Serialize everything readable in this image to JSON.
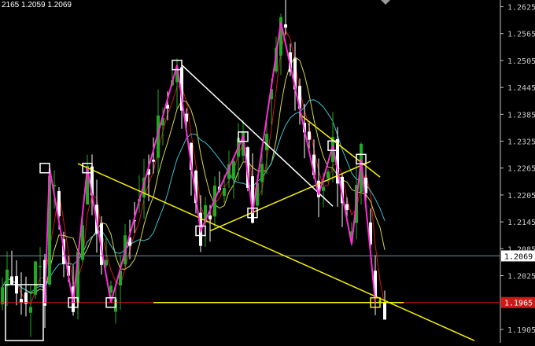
{
  "header": {
    "ohlc_text": "2165 1.2059 1.2069"
  },
  "colors": {
    "background": "#000000",
    "axis": "#c8c8c8",
    "bull_candle": "#1faa1f",
    "bear_candle": "#ffffff",
    "zigzag": "#ff2bd6",
    "trend_yellow": "#f5f200",
    "trend_white": "#ffffff",
    "ma_red": "#d01818",
    "ma_yellow": "#d6d650",
    "ma_cyan": "#3fbfcf",
    "current_price_line": "#7a8a9a",
    "alert_line": "#d01818",
    "current_price_badge_bg": "#ffffff",
    "current_price_badge_fg": "#000000",
    "alert_badge_bg": "#d01818",
    "alert_badge_fg": "#ffffff"
  },
  "price_axis": {
    "labels": [
      "1.2625",
      "1.2565",
      "1.2505",
      "1.2445",
      "1.2385",
      "1.2325",
      "1.2265",
      "1.2205",
      "1.2145",
      "1.2085",
      "1.2025",
      "1.1905"
    ],
    "current_price": "1.2069",
    "alert_price": "1.1965"
  },
  "chart_data": {
    "type": "candlestick",
    "y_range": [
      1.1875,
      1.264
    ],
    "candle_count": 82,
    "zigzag": [
      [
        9,
        1.1965
      ],
      [
        10,
        1.2265
      ],
      [
        15,
        1.1965
      ],
      [
        18,
        1.2265
      ],
      [
        23,
        1.1965
      ],
      [
        37,
        1.2495
      ],
      [
        42,
        1.2125
      ],
      [
        51,
        1.2335
      ],
      [
        53,
        1.2165
      ],
      [
        59,
        1.259
      ],
      [
        67,
        1.2205
      ],
      [
        70,
        1.2315
      ],
      [
        74,
        1.2095
      ],
      [
        76,
        1.2285
      ],
      [
        78,
        1.2075
      ],
      [
        79,
        1.1965
      ]
    ],
    "boxes": [
      [
        9,
        1.2265
      ],
      [
        15,
        1.1965
      ],
      [
        18,
        1.2265
      ],
      [
        23,
        1.1965
      ],
      [
        37,
        1.2495
      ],
      [
        42,
        1.2125
      ],
      [
        51,
        1.2335
      ],
      [
        53,
        1.2165
      ],
      [
        70,
        1.2315
      ],
      [
        76,
        1.2285
      ],
      [
        79,
        1.1965
      ]
    ],
    "trendlines": [
      {
        "color": "yellow",
        "from": [
          16,
          1.2275
        ],
        "to": [
          100,
          1.188
        ]
      },
      {
        "color": "yellow",
        "from": [
          32,
          1.1965
        ],
        "to": [
          85,
          1.1965
        ]
      },
      {
        "color": "yellow",
        "from": [
          44,
          1.2125
        ],
        "to": [
          78,
          1.228
        ]
      },
      {
        "color": "yellow",
        "from": [
          63,
          1.2385
        ],
        "to": [
          80,
          1.2245
        ]
      },
      {
        "color": "white",
        "from": [
          38,
          1.2495
        ],
        "to": [
          70,
          1.218
        ]
      }
    ],
    "highlight_box": {
      "from": [
        1,
        1.188
      ],
      "to": [
        8,
        1.2005
      ]
    }
  }
}
